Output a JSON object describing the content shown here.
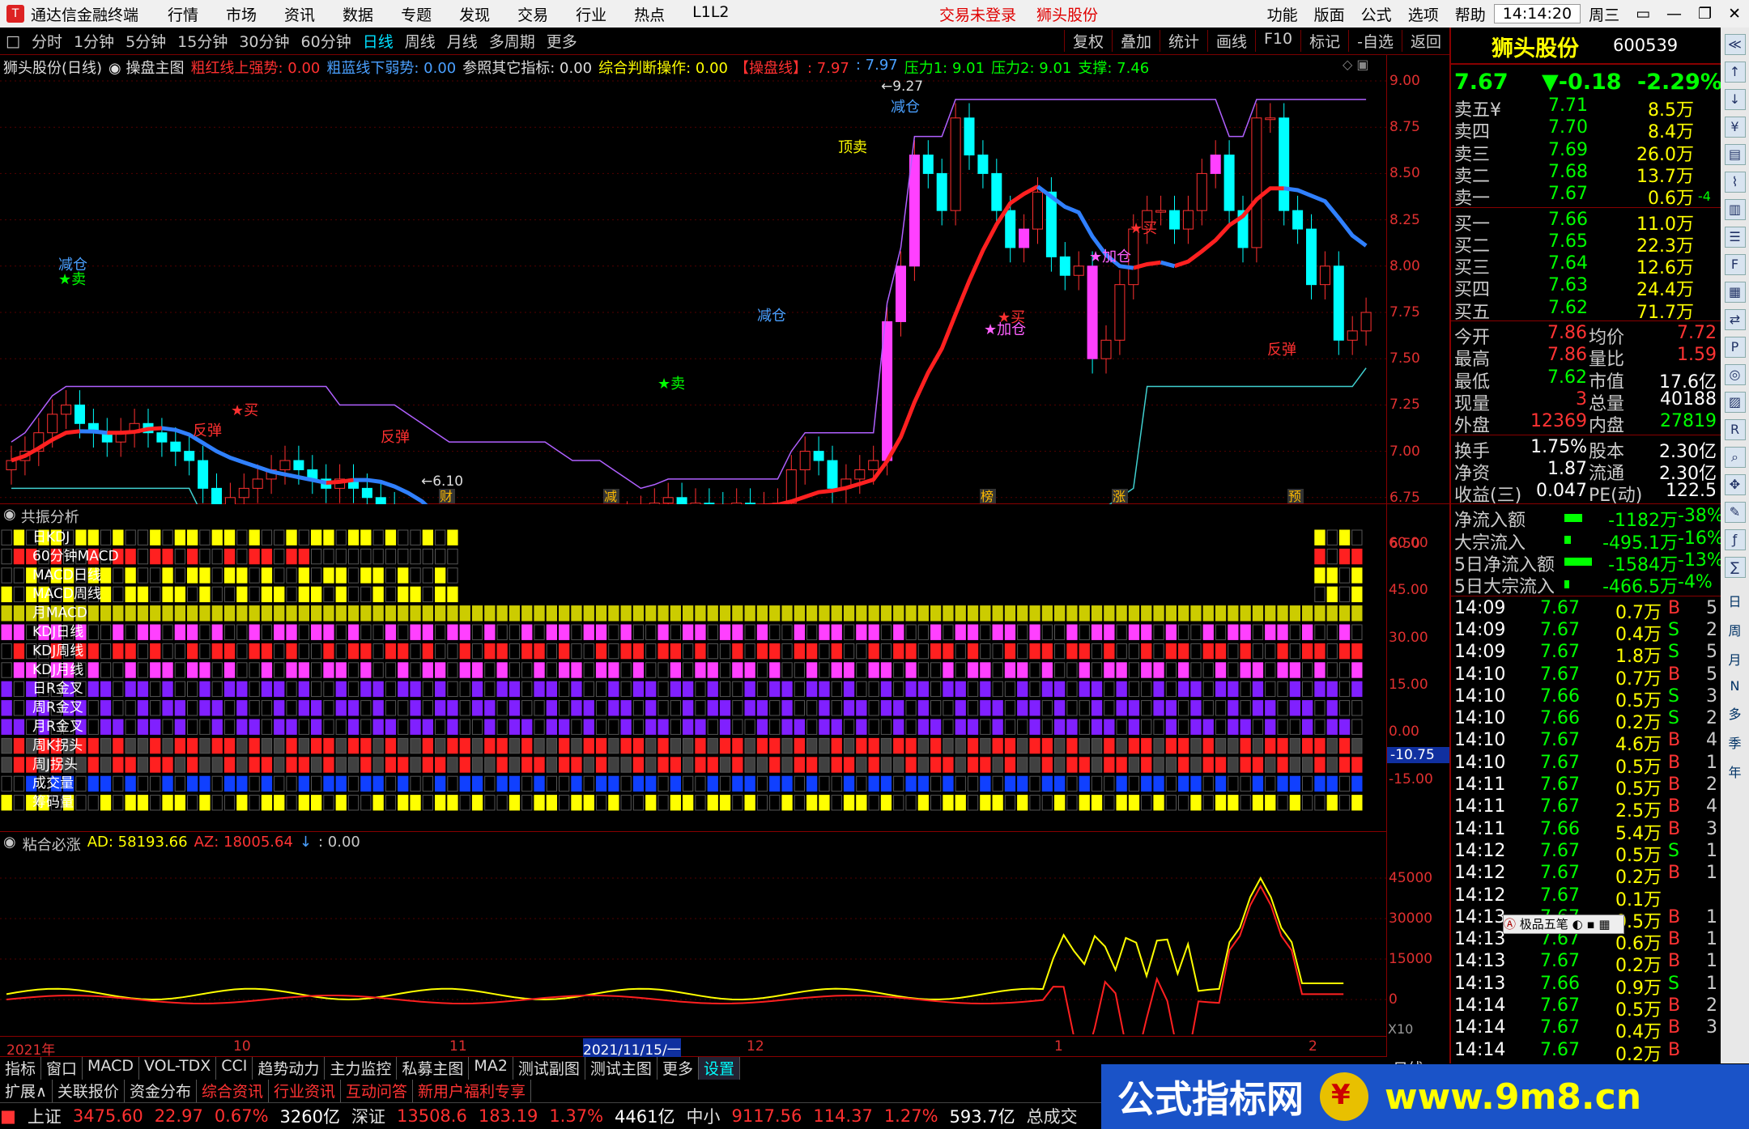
{
  "app": {
    "name": "通达信金融终端",
    "menus": [
      "行情",
      "市场",
      "资讯",
      "数据",
      "专题",
      "发现",
      "交易",
      "行业",
      "热点",
      "L1L2"
    ],
    "login": "交易未登录",
    "stock_title": "狮头股份",
    "right_menus": [
      "功能",
      "版面",
      "公式",
      "选项",
      "帮助"
    ],
    "time": "14:14:20",
    "weekday": "周三"
  },
  "periods": {
    "items": [
      "分时",
      "1分钟",
      "5分钟",
      "15分钟",
      "30分钟",
      "60分钟",
      "日线",
      "周线",
      "月线",
      "多周期",
      "更多"
    ],
    "selected": "日线",
    "right": [
      "复权",
      "叠加",
      "统计",
      "画线",
      "F10",
      "标记",
      "-自选",
      "返回"
    ]
  },
  "main": {
    "title": "狮头股份(日线)",
    "formula": "操盘主图",
    "ind": [
      {
        "t": "粗红线上强势: 0.00",
        "c": "#ff3030"
      },
      {
        "t": "粗蓝线下弱势: 0.00",
        "c": "#4aa0ff"
      },
      {
        "t": "参照其它指标: 0.00",
        "c": "#dddddd"
      },
      {
        "t": "综合判断操作: 0.00",
        "c": "#ffff00"
      },
      {
        "t": "【操盘线】: 7.97",
        "c": "#ff3030"
      },
      {
        "t": ": 7.97",
        "c": "#4aa0ff"
      },
      {
        "t": "压力1: 9.01",
        "c": "#00ff00"
      },
      {
        "t": "压力2: 9.01",
        "c": "#00ff00"
      },
      {
        "t": "支撑: 7.46",
        "c": "#00ff00"
      }
    ],
    "ylabels": [
      "9.00",
      "8.75",
      "8.50",
      "8.25",
      "8.00",
      "7.75",
      "7.50",
      "7.25",
      "7.00",
      "6.75",
      "6.50"
    ],
    "high_mark": "9.27",
    "low_mark": "6.10",
    "annos": [
      {
        "t": "减仓",
        "c": "#4aa0ff"
      },
      {
        "t": "★卖",
        "c": "#00ff00"
      },
      {
        "t": "反弹",
        "c": "#ff3030"
      },
      {
        "t": "★买",
        "c": "#ff3030"
      },
      {
        "t": "反弹",
        "c": "#ff3030"
      },
      {
        "t": "减仓",
        "c": "#4aa0ff"
      },
      {
        "t": "★卖",
        "c": "#00ff00"
      },
      {
        "t": "顶卖",
        "c": "#ffff00"
      },
      {
        "t": "减仓",
        "c": "#4aa0ff"
      },
      {
        "t": "★买",
        "c": "#ff3030"
      },
      {
        "t": "★加仓",
        "c": "#ff60ff"
      },
      {
        "t": "★加仓",
        "c": "#ff60ff"
      },
      {
        "t": "★买",
        "c": "#ff3030"
      },
      {
        "t": "反弹",
        "c": "#ff3030"
      }
    ],
    "events": [
      "财",
      "减",
      "榜",
      "涨",
      "预"
    ]
  },
  "res": {
    "title": "共振分析",
    "rows": [
      "日KDJ",
      "60分钟MACD",
      "MACD日线",
      "MACD周线",
      "月MACD",
      "KDJ日线",
      "KDJ周线",
      "KDJ月线",
      "日R金叉",
      "周R金叉",
      "月R金叉",
      "周K拐头",
      "周J拐头",
      "成交量",
      "筹码量"
    ],
    "ylabels": [
      "60.00",
      "45.00",
      "30.00",
      "15.00",
      "0.00",
      "-15.00"
    ],
    "mark": "-10.75"
  },
  "ind": {
    "title": "粘合必涨",
    "ad": "AD: 58193.66",
    "az": "AZ: 18005.64",
    "z": ": 0.00",
    "ylabels": [
      "45000",
      "30000",
      "15000",
      "0"
    ],
    "x10": "X10"
  },
  "xaxis": {
    "labels": [
      "2021年",
      "10",
      "11",
      "2021/11/15/一",
      "12",
      "1",
      "2"
    ],
    "period": "日线"
  },
  "quote": {
    "name": "狮头股份",
    "code": "600539",
    "price": "7.67",
    "chg": "▼-0.18",
    "pct": "-2.29%",
    "asks": [
      [
        "卖五¥",
        "7.71",
        "8.5万"
      ],
      [
        "卖四",
        "7.70",
        "8.4万"
      ],
      [
        "卖三",
        "7.69",
        "26.0万"
      ],
      [
        "卖二",
        "7.68",
        "13.7万"
      ],
      [
        "卖一",
        "7.67",
        "0.6万"
      ]
    ],
    "ask1_delta": "-4",
    "bids": [
      [
        "买一",
        "7.66",
        "11.0万"
      ],
      [
        "买二",
        "7.65",
        "22.3万"
      ],
      [
        "买三",
        "7.64",
        "12.6万"
      ],
      [
        "买四",
        "7.63",
        "24.4万"
      ],
      [
        "买五",
        "7.62",
        "71.7万"
      ]
    ],
    "stats": [
      [
        "今开",
        "7.86",
        "均价",
        "7.72"
      ],
      [
        "最高",
        "7.86",
        "量比",
        "1.59"
      ],
      [
        "最低",
        "7.62",
        "市值",
        "17.6亿"
      ],
      [
        "现量",
        "3",
        "总量",
        "40188"
      ],
      [
        "外盘",
        "12369",
        "内盘",
        "27819"
      ]
    ],
    "fin": [
      [
        "换手",
        "1.75%",
        "股本",
        "2.30亿"
      ],
      [
        "净资",
        "1.87",
        "流通",
        "2.30亿"
      ],
      [
        "收益(三)",
        "0.047",
        "PE(动)",
        "122.5"
      ]
    ],
    "flows": [
      [
        "净流入额",
        "-1182万",
        "-38%"
      ],
      [
        "大宗流入",
        "-495.1万",
        "-16%"
      ],
      [
        "5日净流入额",
        "-1584万",
        "-13%"
      ],
      [
        "5日大宗流入",
        "-466.5万",
        "-4%"
      ]
    ],
    "ticks": [
      [
        "14:09",
        "7.67",
        "0.7万",
        "B",
        "5"
      ],
      [
        "14:09",
        "7.67",
        "0.4万",
        "S",
        "2"
      ],
      [
        "14:09",
        "7.67",
        "1.8万",
        "S",
        "5"
      ],
      [
        "14:10",
        "7.67",
        "0.7万",
        "B",
        "5"
      ],
      [
        "14:10",
        "7.66",
        "0.5万",
        "S",
        "3"
      ],
      [
        "14:10",
        "7.66",
        "0.2万",
        "S",
        "2"
      ],
      [
        "14:10",
        "7.67",
        "4.6万",
        "B",
        "4"
      ],
      [
        "14:10",
        "7.67",
        "0.5万",
        "B",
        "1"
      ],
      [
        "14:11",
        "7.67",
        "0.5万",
        "B",
        "2"
      ],
      [
        "14:11",
        "7.67",
        "2.5万",
        "B",
        "4"
      ],
      [
        "14:11",
        "7.66",
        "5.4万",
        "B",
        "3"
      ],
      [
        "14:12",
        "7.67",
        "0.5万",
        "S",
        "1"
      ],
      [
        "14:12",
        "7.67",
        "0.2万",
        "B",
        "1"
      ],
      [
        "14:12",
        "7.67",
        "0.1万",
        "",
        ""
      ],
      [
        "14:13",
        "7.67",
        "0.5万",
        "B",
        "1"
      ],
      [
        "14:13",
        "7.67",
        "0.6万",
        "B",
        "1"
      ],
      [
        "14:13",
        "7.67",
        "0.2万",
        "B",
        "1"
      ],
      [
        "14:13",
        "7.66",
        "0.9万",
        "S",
        "1"
      ],
      [
        "14:14",
        "7.67",
        "0.5万",
        "B",
        "2"
      ],
      [
        "14:14",
        "7.67",
        "0.4万",
        "B",
        "3"
      ],
      [
        "14:14",
        "7.67",
        "0.2万",
        "B",
        ""
      ]
    ],
    "ime": "极品五笔"
  },
  "sidebar": [
    "日",
    "周",
    "月",
    "N",
    "多",
    "季",
    "年"
  ],
  "tabs1": [
    "指标",
    "窗口",
    "MACD",
    "VOL-TDX",
    "CCI",
    "趋势动力",
    "主力监控",
    "私募主图",
    "MA2",
    "测试副图",
    "测试主图",
    "更多",
    "设置"
  ],
  "tabs2": [
    "扩展∧",
    "关联报价",
    "资金分布",
    "综合资讯",
    "行业资讯",
    "互动问答",
    "新用户福利专享"
  ],
  "status": [
    {
      "t": "上证",
      "c": "#dddddd"
    },
    {
      "t": "3475.60",
      "c": "#ff3030"
    },
    {
      "t": "22.97",
      "c": "#ff3030"
    },
    {
      "t": "0.67%",
      "c": "#ff3030"
    },
    {
      "t": "3260亿",
      "c": "#ffffff"
    },
    {
      "t": "深证",
      "c": "#dddddd"
    },
    {
      "t": "13508.6",
      "c": "#ff3030"
    },
    {
      "t": "183.19",
      "c": "#ff3030"
    },
    {
      "t": "1.37%",
      "c": "#ff3030"
    },
    {
      "t": "4461亿",
      "c": "#ffffff"
    },
    {
      "t": "中小",
      "c": "#dddddd"
    },
    {
      "t": "9117.56",
      "c": "#ff3030"
    },
    {
      "t": "114.37",
      "c": "#ff3030"
    },
    {
      "t": "1.27%",
      "c": "#ff3030"
    },
    {
      "t": "593.7亿",
      "c": "#ffffff"
    },
    {
      "t": "总成交",
      "c": "#dddddd"
    }
  ],
  "watermark": {
    "text": "公式指标网",
    "url": "www.9m8.cn"
  }
}
